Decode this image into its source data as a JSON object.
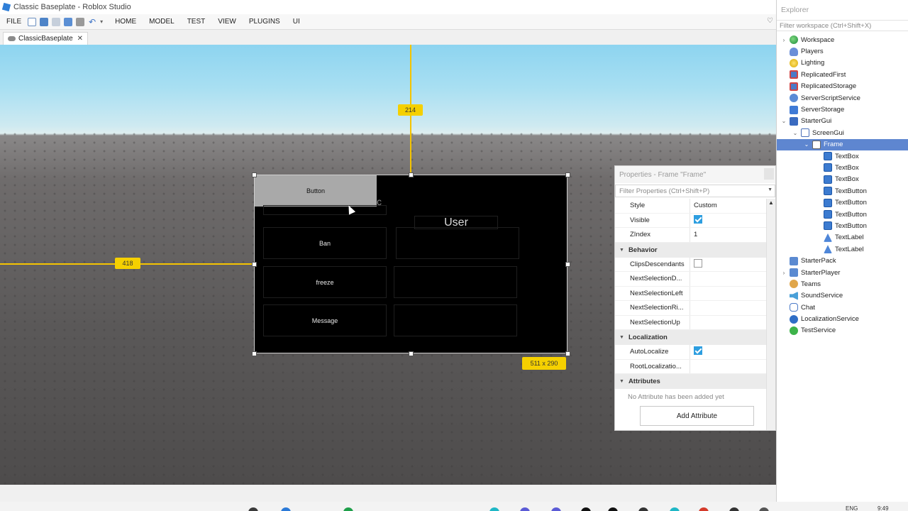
{
  "window": {
    "title": "Classic Baseplate - Roblox Studio"
  },
  "menu": {
    "file": "FILE",
    "tabs": [
      "HOME",
      "MODEL",
      "TEST",
      "VIEW",
      "PLUGINS",
      "UI"
    ]
  },
  "doc_tab": {
    "label": "ClassicBaseplate",
    "close": "✕"
  },
  "viewport": {
    "guide_top_value": "214",
    "guide_left_value": "418",
    "size_value": "511 x 290",
    "gui": {
      "top_button": "Button",
      "hidden_text": "c",
      "user_label": "User",
      "buttons": [
        "Ban",
        "freeze",
        "Message"
      ]
    }
  },
  "properties": {
    "title": "Properties - Frame \"Frame\"",
    "filter_placeholder": "Filter Properties (Ctrl+Shift+P)",
    "rows_top": [
      {
        "name": "Style",
        "value": "Custom"
      },
      {
        "name": "Visible",
        "checked": true
      },
      {
        "name": "ZIndex",
        "value": "1"
      }
    ],
    "behavior": {
      "header": "Behavior",
      "rows": [
        {
          "name": "ClipsDescendants",
          "checked": false
        },
        {
          "name": "NextSelectionD...",
          "value": ""
        },
        {
          "name": "NextSelectionLeft",
          "value": ""
        },
        {
          "name": "NextSelectionRi...",
          "value": ""
        },
        {
          "name": "NextSelectionUp",
          "value": ""
        }
      ]
    },
    "localization": {
      "header": "Localization",
      "rows": [
        {
          "name": "AutoLocalize",
          "checked": true
        },
        {
          "name": "RootLocalizatio...",
          "value": ""
        }
      ]
    },
    "attributes": {
      "header": "Attributes",
      "empty_text": "No Attribute has been added yet",
      "add_button": "Add Attribute"
    }
  },
  "explorer": {
    "title": "Explorer",
    "filter_placeholder": "Filter workspace (Ctrl+Shift+X)",
    "items": [
      {
        "label": "Workspace",
        "icon": "workspace-icon",
        "chev": "›",
        "indent": 0
      },
      {
        "label": "Players",
        "icon": "players-icon",
        "chev": "",
        "indent": 0
      },
      {
        "label": "Lighting",
        "icon": "lighting-icon",
        "chev": "",
        "indent": 0
      },
      {
        "label": "ReplicatedFirst",
        "icon": "replicated-first-icon",
        "chev": "",
        "indent": 0
      },
      {
        "label": "ReplicatedStorage",
        "icon": "replicated-storage-icon",
        "chev": "",
        "indent": 0
      },
      {
        "label": "ServerScriptService",
        "icon": "server-script-service-icon",
        "chev": "",
        "indent": 0
      },
      {
        "label": "ServerStorage",
        "icon": "server-storage-icon",
        "chev": "",
        "indent": 0
      },
      {
        "label": "StarterGui",
        "icon": "starter-gui-icon",
        "chev": "⌄",
        "indent": 0
      },
      {
        "label": "ScreenGui",
        "icon": "screen-gui-icon",
        "chev": "⌄",
        "indent": 1
      },
      {
        "label": "Frame",
        "icon": "frame-icon",
        "chev": "⌄",
        "indent": 2,
        "selected": true
      },
      {
        "label": "TextBox",
        "icon": "textbox-icon",
        "chev": "",
        "indent": 3
      },
      {
        "label": "TextBox",
        "icon": "textbox-icon",
        "chev": "",
        "indent": 3
      },
      {
        "label": "TextBox",
        "icon": "textbox-icon",
        "chev": "",
        "indent": 3
      },
      {
        "label": "TextButton",
        "icon": "textbutton-icon",
        "chev": "",
        "indent": 3
      },
      {
        "label": "TextButton",
        "icon": "textbutton-icon",
        "chev": "",
        "indent": 3
      },
      {
        "label": "TextButton",
        "icon": "textbutton-icon",
        "chev": "",
        "indent": 3
      },
      {
        "label": "TextButton",
        "icon": "textbutton-icon",
        "chev": "",
        "indent": 3
      },
      {
        "label": "TextLabel",
        "icon": "textlabel-icon",
        "chev": "",
        "indent": 3
      },
      {
        "label": "TextLabel",
        "icon": "textlabel-icon",
        "chev": "",
        "indent": 3
      },
      {
        "label": "StarterPack",
        "icon": "starter-pack-icon",
        "chev": "",
        "indent": 0
      },
      {
        "label": "StarterPlayer",
        "icon": "starter-player-icon",
        "chev": "›",
        "indent": 0
      },
      {
        "label": "Teams",
        "icon": "teams-icon",
        "chev": "",
        "indent": 0
      },
      {
        "label": "SoundService",
        "icon": "sound-service-icon",
        "chev": "",
        "indent": 0
      },
      {
        "label": "Chat",
        "icon": "chat-icon",
        "chev": "",
        "indent": 0
      },
      {
        "label": "LocalizationService",
        "icon": "localization-service-icon",
        "chev": "",
        "indent": 0
      },
      {
        "label": "TestService",
        "icon": "test-service-icon",
        "chev": "",
        "indent": 0
      }
    ]
  },
  "taskbar": {
    "lang": "ENG",
    "time": "9:49"
  },
  "colors": {
    "guide": "#f5c400",
    "selection": "#5e86d0",
    "checkbox": "#2d9ee0"
  }
}
